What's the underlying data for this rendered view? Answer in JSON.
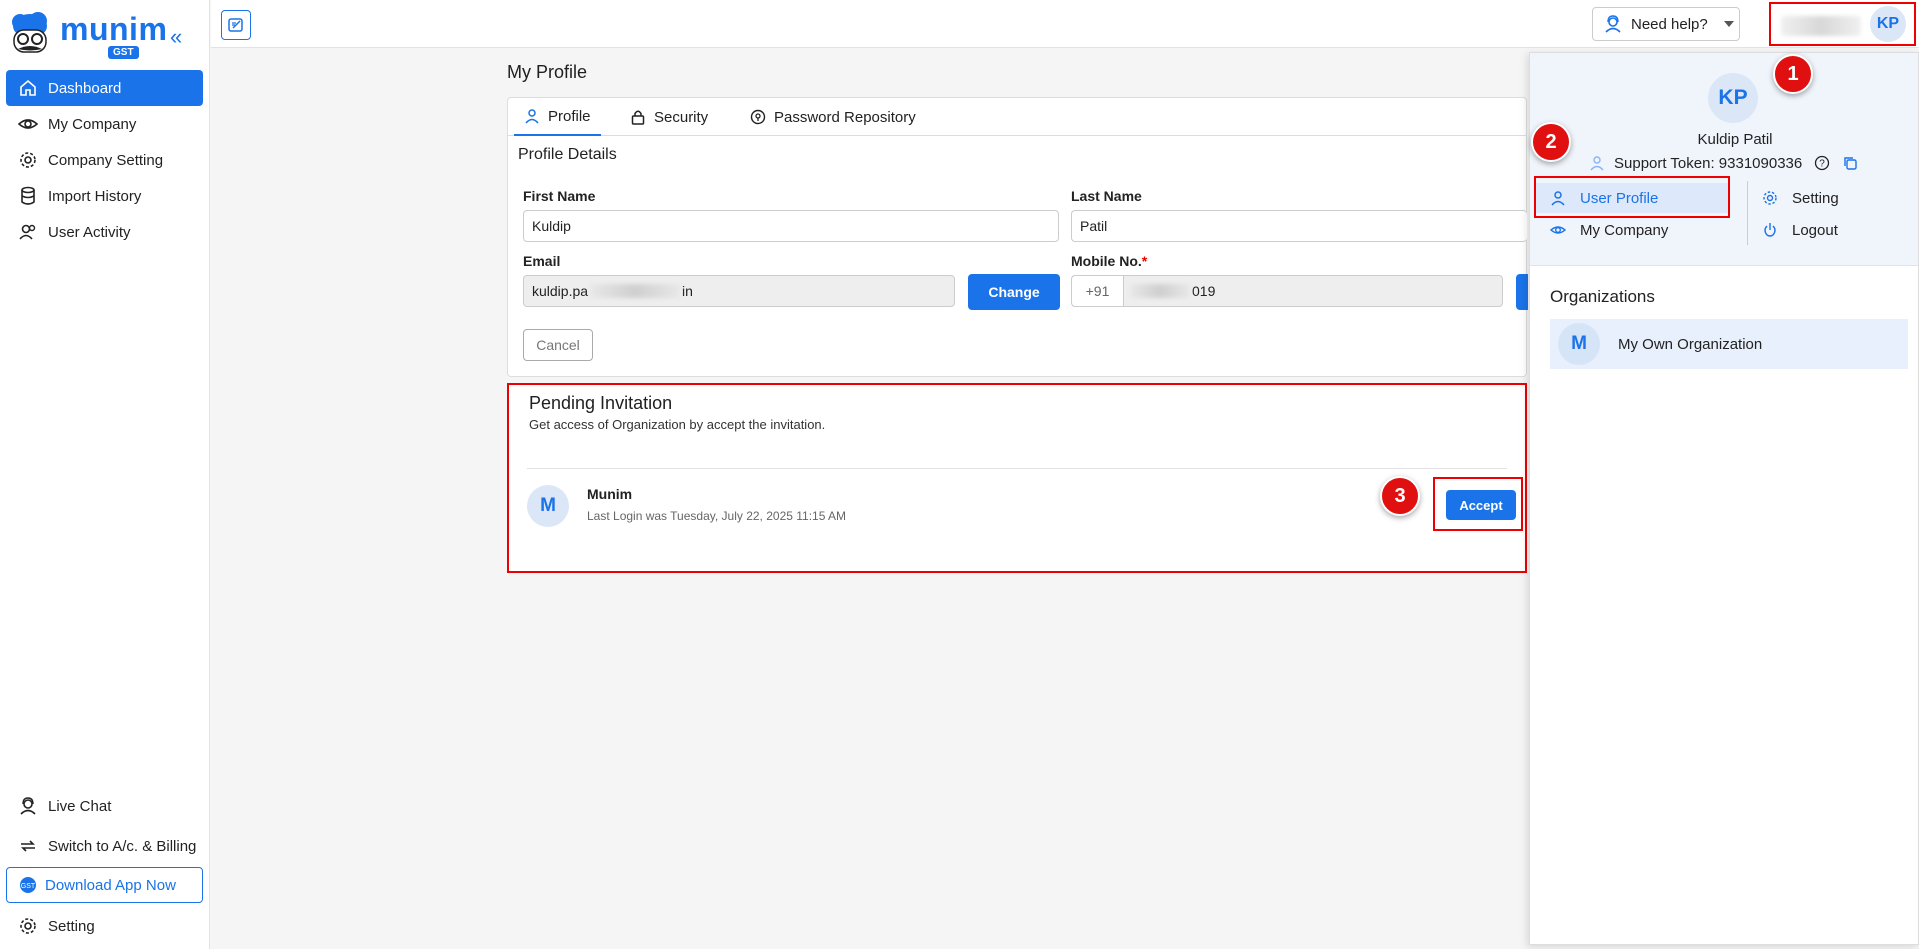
{
  "brand": {
    "word": "munim",
    "tag": "GST",
    "color": "#1a73e8"
  },
  "sidebar": {
    "items": [
      {
        "label": "Dashboard",
        "icon": "home-icon"
      },
      {
        "label": "My Company",
        "icon": "eye-icon"
      },
      {
        "label": "Company Setting",
        "icon": "gear-icon"
      },
      {
        "label": "Import History",
        "icon": "database-icon"
      },
      {
        "label": "User Activity",
        "icon": "users-icon"
      }
    ],
    "bottom": [
      {
        "label": "Live Chat",
        "icon": "support-agent-icon"
      },
      {
        "label": "Switch to A/c. & Billing",
        "icon": "switch-icon"
      },
      {
        "label": "Download App Now",
        "icon": "app-badge-icon"
      },
      {
        "label": "Setting",
        "icon": "gear-icon"
      }
    ]
  },
  "topbar": {
    "help_label": "Need help?",
    "avatar_initials": "KP"
  },
  "page": {
    "title": "My Profile"
  },
  "tabs": [
    {
      "label": "Profile",
      "icon": "user-icon"
    },
    {
      "label": "Security",
      "icon": "lock-icon"
    },
    {
      "label": "Password Repository",
      "icon": "key-shield-icon"
    }
  ],
  "profile": {
    "section_title": "Profile Details",
    "first_name_label": "First Name",
    "first_name": "Kuldip",
    "last_name_label": "Last Name",
    "last_name": "Patil",
    "email_label": "Email",
    "email_start": "kuldip.pa",
    "email_end": "in",
    "change_label": "Change",
    "mobile_label": "Mobile No.",
    "mobile_prefix": "+91",
    "mobile_end": "019",
    "cancel_label": "Cancel"
  },
  "invitation": {
    "title": "Pending Invitation",
    "subtitle": "Get access of Organization by accept the invitation.",
    "avatar": "M",
    "org_name": "Munim",
    "last_login": "Last Login was Tuesday, July 22, 2025 11:15 AM",
    "accept_label": "Accept"
  },
  "dropdown": {
    "avatar": "KP",
    "name": "Kuldip Patil",
    "token_label": "Support Token: 9331090336",
    "menu": [
      {
        "label": "User Profile",
        "icon": "user-icon"
      },
      {
        "label": "Setting",
        "icon": "gear-icon"
      },
      {
        "label": "My Company",
        "icon": "eye-icon"
      },
      {
        "label": "Logout",
        "icon": "power-icon"
      }
    ],
    "org_title": "Organizations",
    "org": {
      "avatar": "M",
      "name": "My Own Organization"
    }
  },
  "badges": [
    "1",
    "2",
    "3"
  ],
  "colors": {
    "primary": "#1a73e8",
    "highlight": "#e00000"
  }
}
